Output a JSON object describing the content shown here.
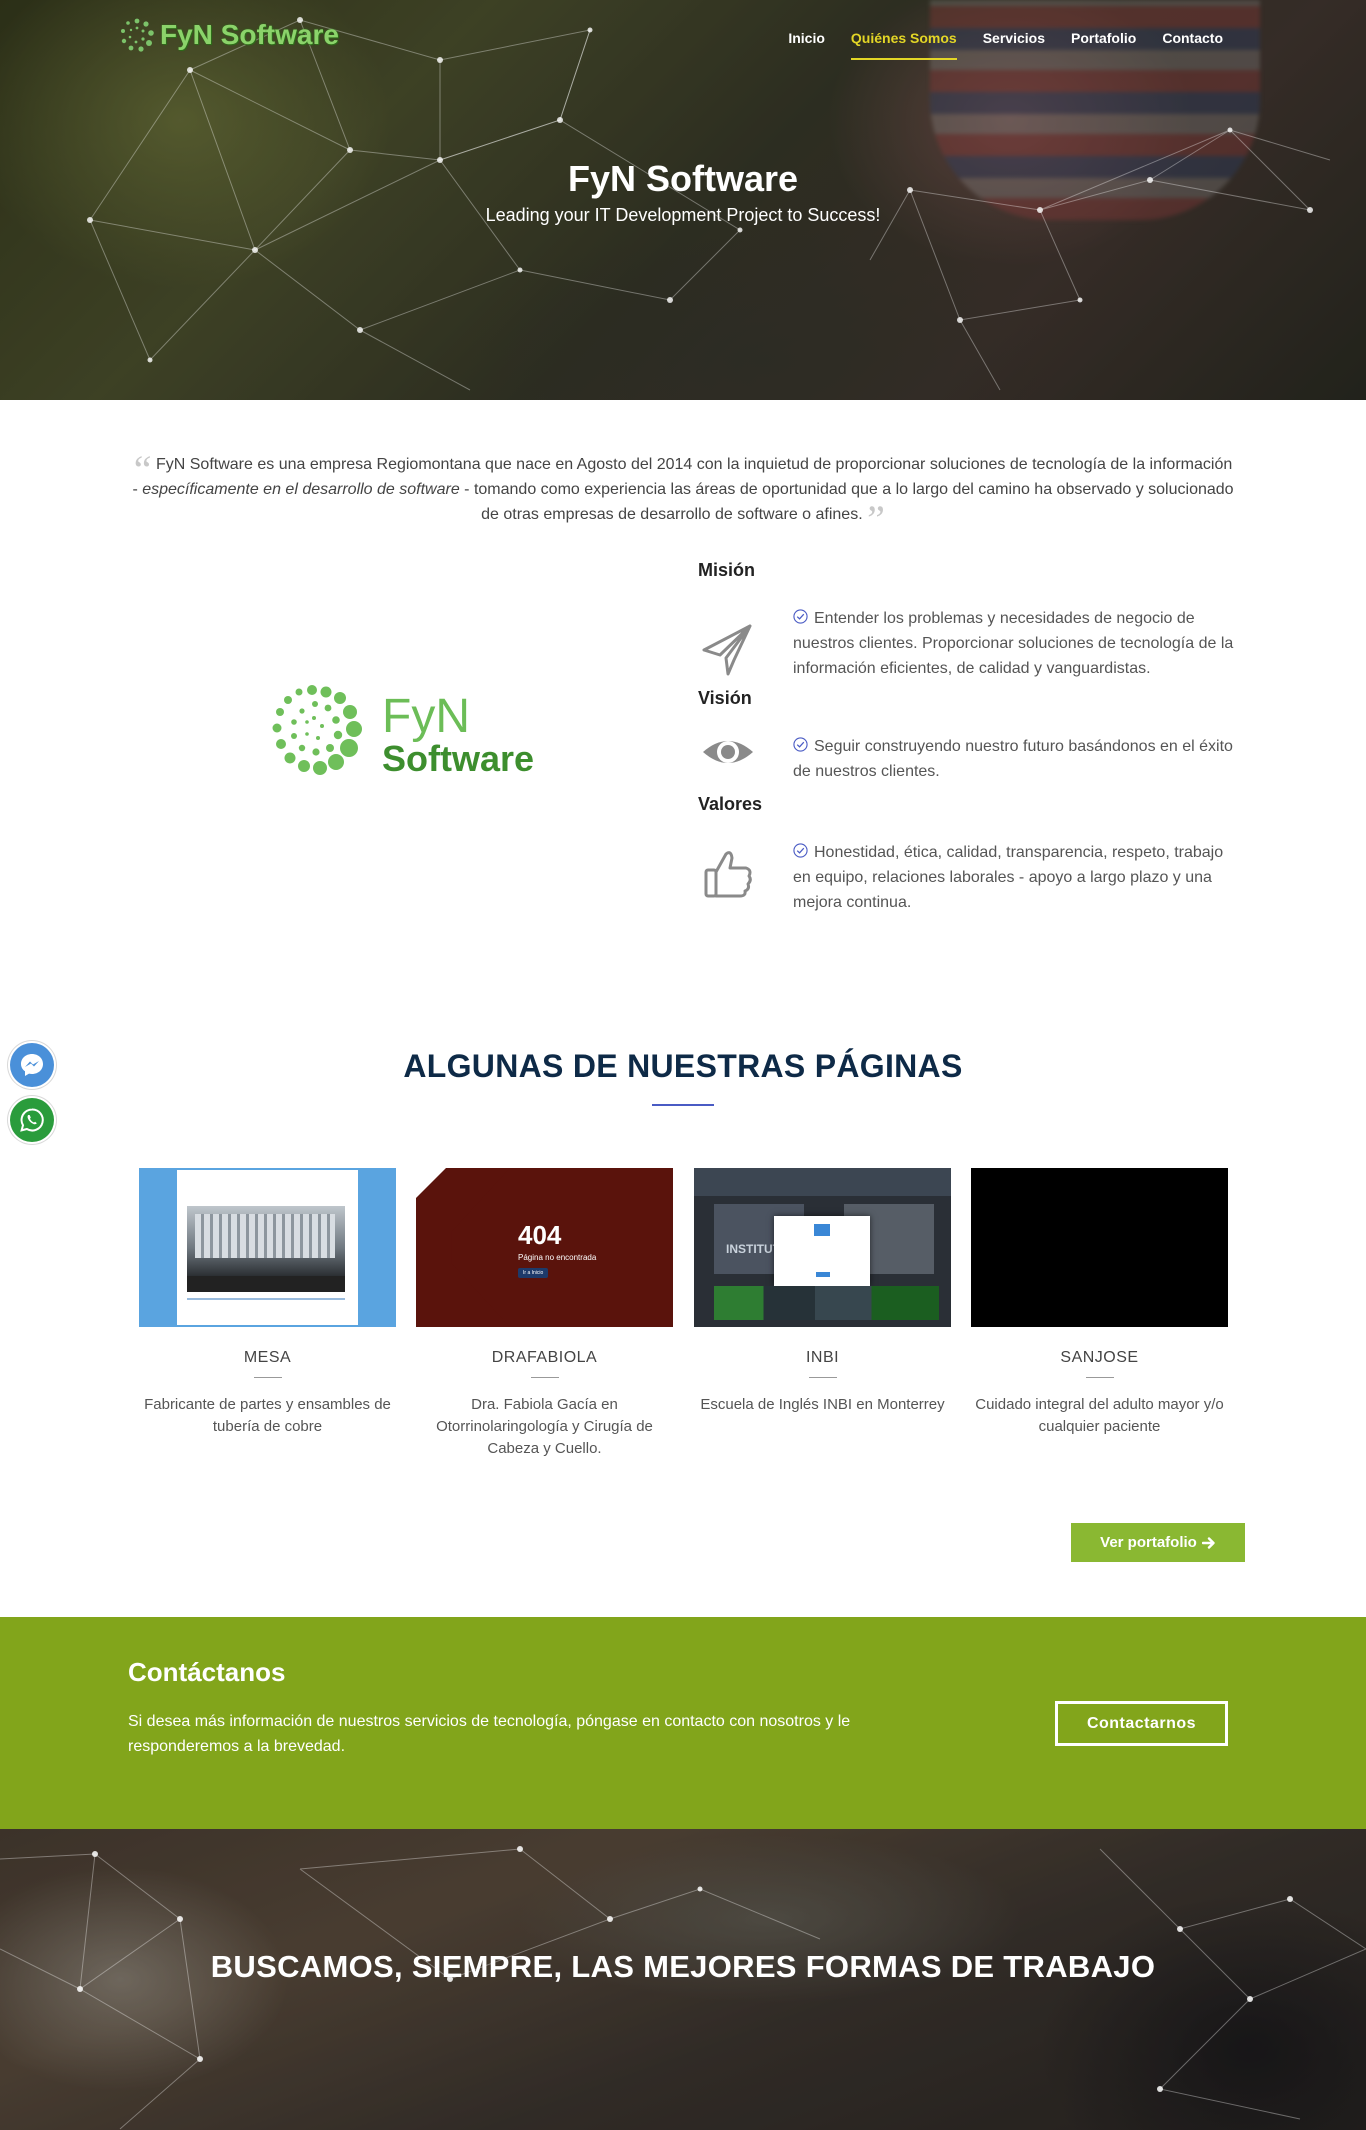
{
  "brand": {
    "name": "FyN Software",
    "logo_icon": "fyn-dots-logo-icon"
  },
  "nav": {
    "items": [
      "Inicio",
      "Quiénes Somos",
      "Servicios",
      "Portafolio",
      "Contacto"
    ],
    "active_index": 1
  },
  "hero": {
    "title": "FyN Software",
    "subtitle": "Leading your IT Development Project to Success!"
  },
  "about": {
    "quote_pre": "FyN Software es una empresa Regiomontana que nace en Agosto del 2014 con la inquietud de proporcionar soluciones de tecnología de la información - ",
    "quote_em": "específicamente en el desarrollo de software",
    "quote_post": " - tomando como experiencia las áreas de oportunidad que a lo largo del camino ha observado y solucionado de otras empresas de desarrollo de software o afines.",
    "logo_line1": "FyN",
    "logo_line2": "Software",
    "mision": {
      "title": "Misión",
      "text": "Entender los problemas y necesidades de negocio de nuestros clientes. Proporcionar soluciones de tecnología de la información eficientes, de calidad y vanguardistas.",
      "icon": "paper-plane-icon"
    },
    "vision": {
      "title": "Visión",
      "text": "Seguir construyendo nuestro futuro basándonos en el éxito de nuestros clientes.",
      "icon": "eye-icon"
    },
    "valores": {
      "title": "Valores",
      "text": "Honestidad, ética, calidad, transparencia, respeto, trabajo en equipo, relaciones laborales - apoyo a largo plazo y una mejora continua.",
      "icon": "thumbs-up-icon"
    }
  },
  "portfolio": {
    "title": "ALGUNAS DE NUESTRAS PÁGINAS",
    "items": [
      {
        "name": "MESA",
        "desc": "Fabricante de partes y ensambles de tubería de cobre"
      },
      {
        "name": "DRAFABIOLA",
        "desc": "Dra. Fabiola Gacía en Otorrinolaringología y Cirugía de Cabeza y Cuello.",
        "thumb_title": "404",
        "thumb_sub": "Página no encontrada",
        "thumb_btn": "Ir a Inicio"
      },
      {
        "name": "INBI",
        "desc": "Escuela de Inglés INBI en Monterrey",
        "thumb_text": "INSTITUTO"
      },
      {
        "name": "SANJOSE",
        "desc": "Cuidado integral del adulto mayor y/o cualquier paciente"
      }
    ],
    "button": "Ver portafolio"
  },
  "contact": {
    "title": "Contáctanos",
    "text": "Si desea más información de nuestros servicios de tecnología, póngase en contacto con nosotros y le responderemos a la brevedad.",
    "button": "Contactarnos"
  },
  "footer_hero": {
    "title": "BUSCAMOS, SIEMPRE, LAS MEJORES FORMAS DE TRABAJO"
  },
  "social": {
    "messenger_icon": "messenger-icon",
    "whatsapp_icon": "whatsapp-icon"
  },
  "colors": {
    "green": "#82a51b",
    "button_green": "#8ab832",
    "nav_active": "#e3d626",
    "title_navy": "#0e2a47",
    "accent_rule": "#4a5bc4"
  }
}
